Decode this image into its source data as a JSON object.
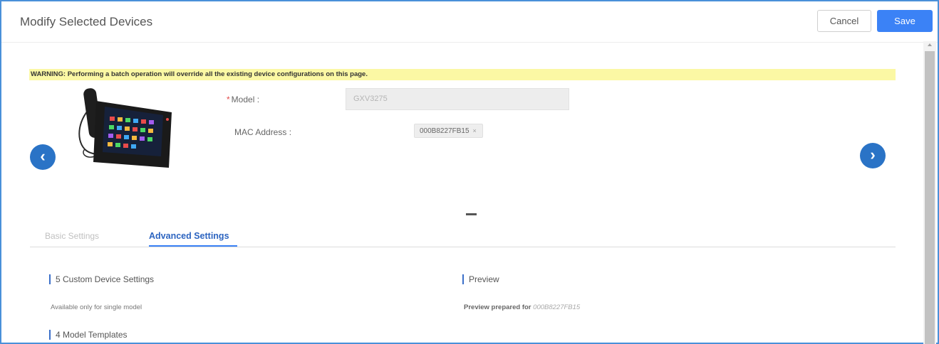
{
  "header": {
    "title": "Modify Selected Devices",
    "cancel_label": "Cancel",
    "save_label": "Save"
  },
  "warning": "WARNING: Performing a batch operation will override all the existing device configurations on this page.",
  "form": {
    "model_required_mark": "*",
    "model_label": "Model :",
    "model_value": "GXV3275",
    "mac_label": "MAC Address :",
    "mac_tag": "000B8227FB15",
    "mac_tag_remove": "×"
  },
  "nav": {
    "prev": "‹",
    "next": "›"
  },
  "tabs": [
    {
      "label": "Basic Settings",
      "active": false
    },
    {
      "label": "Advanced Settings",
      "active": true
    }
  ],
  "sections": {
    "custom_title": "5 Custom Device Settings",
    "custom_note": "Available only for single model",
    "preview_title": "Preview",
    "preview_prefix": "Preview prepared for",
    "preview_mac": "000B8227FB15",
    "templates_title": "4 Model Templates"
  },
  "colors": {
    "accent": "#3b82f6",
    "nav_button": "#2a73c6",
    "warning_bg": "#fbf8a4",
    "frame_border": "#4a90d9"
  },
  "icons": {
    "prev": "chevron-left-icon",
    "next": "chevron-right-icon",
    "remove": "close-icon"
  }
}
